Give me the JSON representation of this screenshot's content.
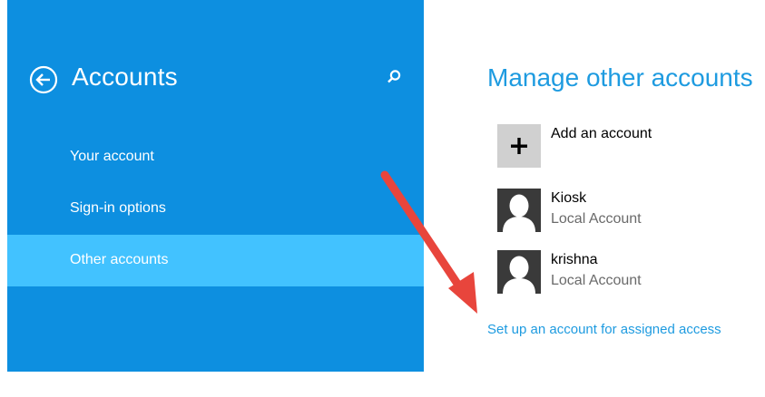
{
  "sidebar": {
    "title": "Accounts",
    "back_icon": "back-arrow-circle-icon",
    "search_icon": "search-icon",
    "items": [
      {
        "label": "Your account",
        "selected": false
      },
      {
        "label": "Sign-in options",
        "selected": false
      },
      {
        "label": "Other accounts",
        "selected": true
      }
    ]
  },
  "main": {
    "title": "Manage other accounts",
    "add_account_label": "Add an account",
    "accounts": [
      {
        "name": "Kiosk",
        "type": "Local Account"
      },
      {
        "name": "krishna",
        "type": "Local Account"
      }
    ],
    "assigned_access_link": "Set up an account for assigned access"
  },
  "colors": {
    "sidebar_bg": "#0d8fe0",
    "selected_item_bg": "#42c2ff",
    "accent_text": "#1e9be0",
    "annotation_arrow": "#e8453c"
  }
}
